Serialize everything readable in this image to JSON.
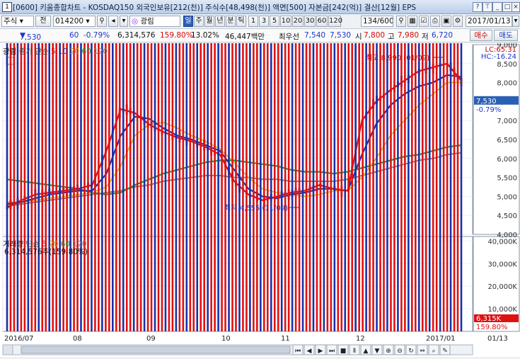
{
  "window": {
    "number": "1",
    "title": "[0600] 키움종합차트 - KOSDAQ150 외국인보유[212(천)] 주식수[48,498(천)] 액면[500] 자본금[242(억)] 결산[12월] EPS"
  },
  "toolbar": {
    "market": "주식",
    "prev_label": "전",
    "code": "014200",
    "stock_name": "광림",
    "periods": [
      "일",
      "주",
      "월",
      "년",
      "분",
      "틱"
    ],
    "selected_period": "일",
    "intervals": [
      "1",
      "3",
      "5",
      "10",
      "20",
      "30",
      "60",
      "120"
    ],
    "count": "134/600",
    "date": "2017/01/13"
  },
  "quote": {
    "price": "7,530",
    "change": "60",
    "change_pct": "-0.79%",
    "volume": "6,314,576",
    "volume_ratio": "159.80%",
    "turnover": "13.02%",
    "market_cap": "46,447백만",
    "preferred_label": "최우선",
    "ask": "7,540",
    "bid": "7,530",
    "open_label": "시",
    "open": "7,800",
    "high_label": "고",
    "high": "7,980",
    "low_label": "저",
    "low": "6,720",
    "buy_button": "매수",
    "sell_button": "매도"
  },
  "price_panel": {
    "legend": {
      "name": "광림",
      "label": "종가 단순",
      "periods": [
        "5",
        "10",
        "20",
        "60",
        "120"
      ]
    },
    "lc": "LC:65.31",
    "hc": "HC:-16.24",
    "current_price_tag": "7,530",
    "current_pct_tag": "-0.79%",
    "annotation_high": "최고 8,990 (01/09)",
    "annotation_low": "최저 4,555 (11/09)"
  },
  "volume_panel": {
    "legend": {
      "name": "거래량",
      "label": "단순",
      "periods": [
        "5",
        "20",
        "60",
        "120"
      ]
    },
    "current_volume": "6,314,576주(159.80%)",
    "current_tag": "6,315K",
    "current_pct_tag": "159.80%"
  },
  "colors": {
    "ma5": "#e01010",
    "ma10": "#1c2fa8",
    "ma20": "#e3b00e",
    "ma60": "#149a3a",
    "ma120": "#808080",
    "up": "#e01010",
    "down": "#1c2fa8"
  },
  "chart_data": [
    {
      "type": "candlestick",
      "title": "광림 종가 단순",
      "series": [
        {
          "name": "5",
          "values": [
            4700,
            4900,
            5050,
            5100,
            5150,
            5200,
            5300,
            6200,
            7300,
            7200,
            6900,
            6700,
            6550,
            6450,
            6300,
            6100,
            5400,
            5050,
            4900,
            5000,
            5100,
            5150,
            5300,
            5200,
            5150,
            7000,
            7500,
            7800,
            8050,
            8300,
            8400,
            8500,
            8050
          ]
        },
        {
          "name": "10",
          "values": [
            4800,
            4850,
            4950,
            5050,
            5100,
            5150,
            5150,
            5600,
            6600,
            7100,
            7050,
            6800,
            6600,
            6500,
            6350,
            6200,
            5700,
            5200,
            5000,
            4950,
            5050,
            5100,
            5200,
            5200,
            5150,
            6100,
            6900,
            7400,
            7700,
            7900,
            8000,
            8200,
            8150
          ]
        },
        {
          "name": "20",
          "values": [
            4850,
            4850,
            4900,
            4950,
            5000,
            5050,
            5100,
            5250,
            5800,
            6600,
            6900,
            6950,
            6800,
            6600,
            6450,
            6250,
            5900,
            5500,
            5200,
            5100,
            5050,
            5000,
            5050,
            5150,
            5150,
            5500,
            6000,
            6600,
            7000,
            7400,
            7700,
            8000,
            8000
          ]
        },
        {
          "name": "60",
          "values": [
            5450,
            5400,
            5350,
            5300,
            5250,
            5200,
            5100,
            5050,
            5100,
            5300,
            5450,
            5600,
            5700,
            5800,
            5900,
            5950,
            5950,
            5900,
            5850,
            5800,
            5700,
            5650,
            5650,
            5600,
            5650,
            5750,
            5850,
            5950,
            6050,
            6100,
            6200,
            6300,
            6350
          ]
        },
        {
          "name": "120",
          "values": [
            4750,
            4800,
            4850,
            4900,
            4950,
            5000,
            5050,
            5100,
            5150,
            5250,
            5300,
            5400,
            5450,
            5500,
            5550,
            5550,
            5500,
            5500,
            5450,
            5450,
            5400,
            5400,
            5400,
            5400,
            5450,
            5550,
            5650,
            5750,
            5850,
            5950,
            6000,
            6100,
            6150
          ]
        }
      ],
      "x": [
        "2016/07",
        "08",
        "09",
        "10",
        "11",
        "12",
        "2017/01",
        "01/13"
      ],
      "ylim": [
        4000,
        9000
      ],
      "ticks": [
        "9,000",
        "8,500",
        "8,000",
        "7,500",
        "7,000",
        "6,500",
        "6,000",
        "5,500",
        "5,000",
        "4,500",
        "4,000"
      ],
      "annotations": [
        "최고 8,990 (01/09)",
        "최저 4,555 (11/09)"
      ]
    },
    {
      "type": "bar",
      "title": "거래량 단순",
      "values_k": [
        800,
        900,
        1200,
        700,
        1500,
        1100,
        900,
        6000,
        20000,
        40000,
        17000,
        12000,
        8000,
        7000,
        6500,
        6000,
        7000,
        8000,
        9000,
        6000,
        5500,
        4500,
        5000,
        4000,
        4500,
        5000,
        20000,
        7000,
        12000,
        9000,
        8000,
        10000,
        6315
      ],
      "ylim": [
        0,
        42000
      ],
      "ticks": [
        "40,000K",
        "30,000K",
        "20,000K",
        "10,000K"
      ]
    }
  ]
}
